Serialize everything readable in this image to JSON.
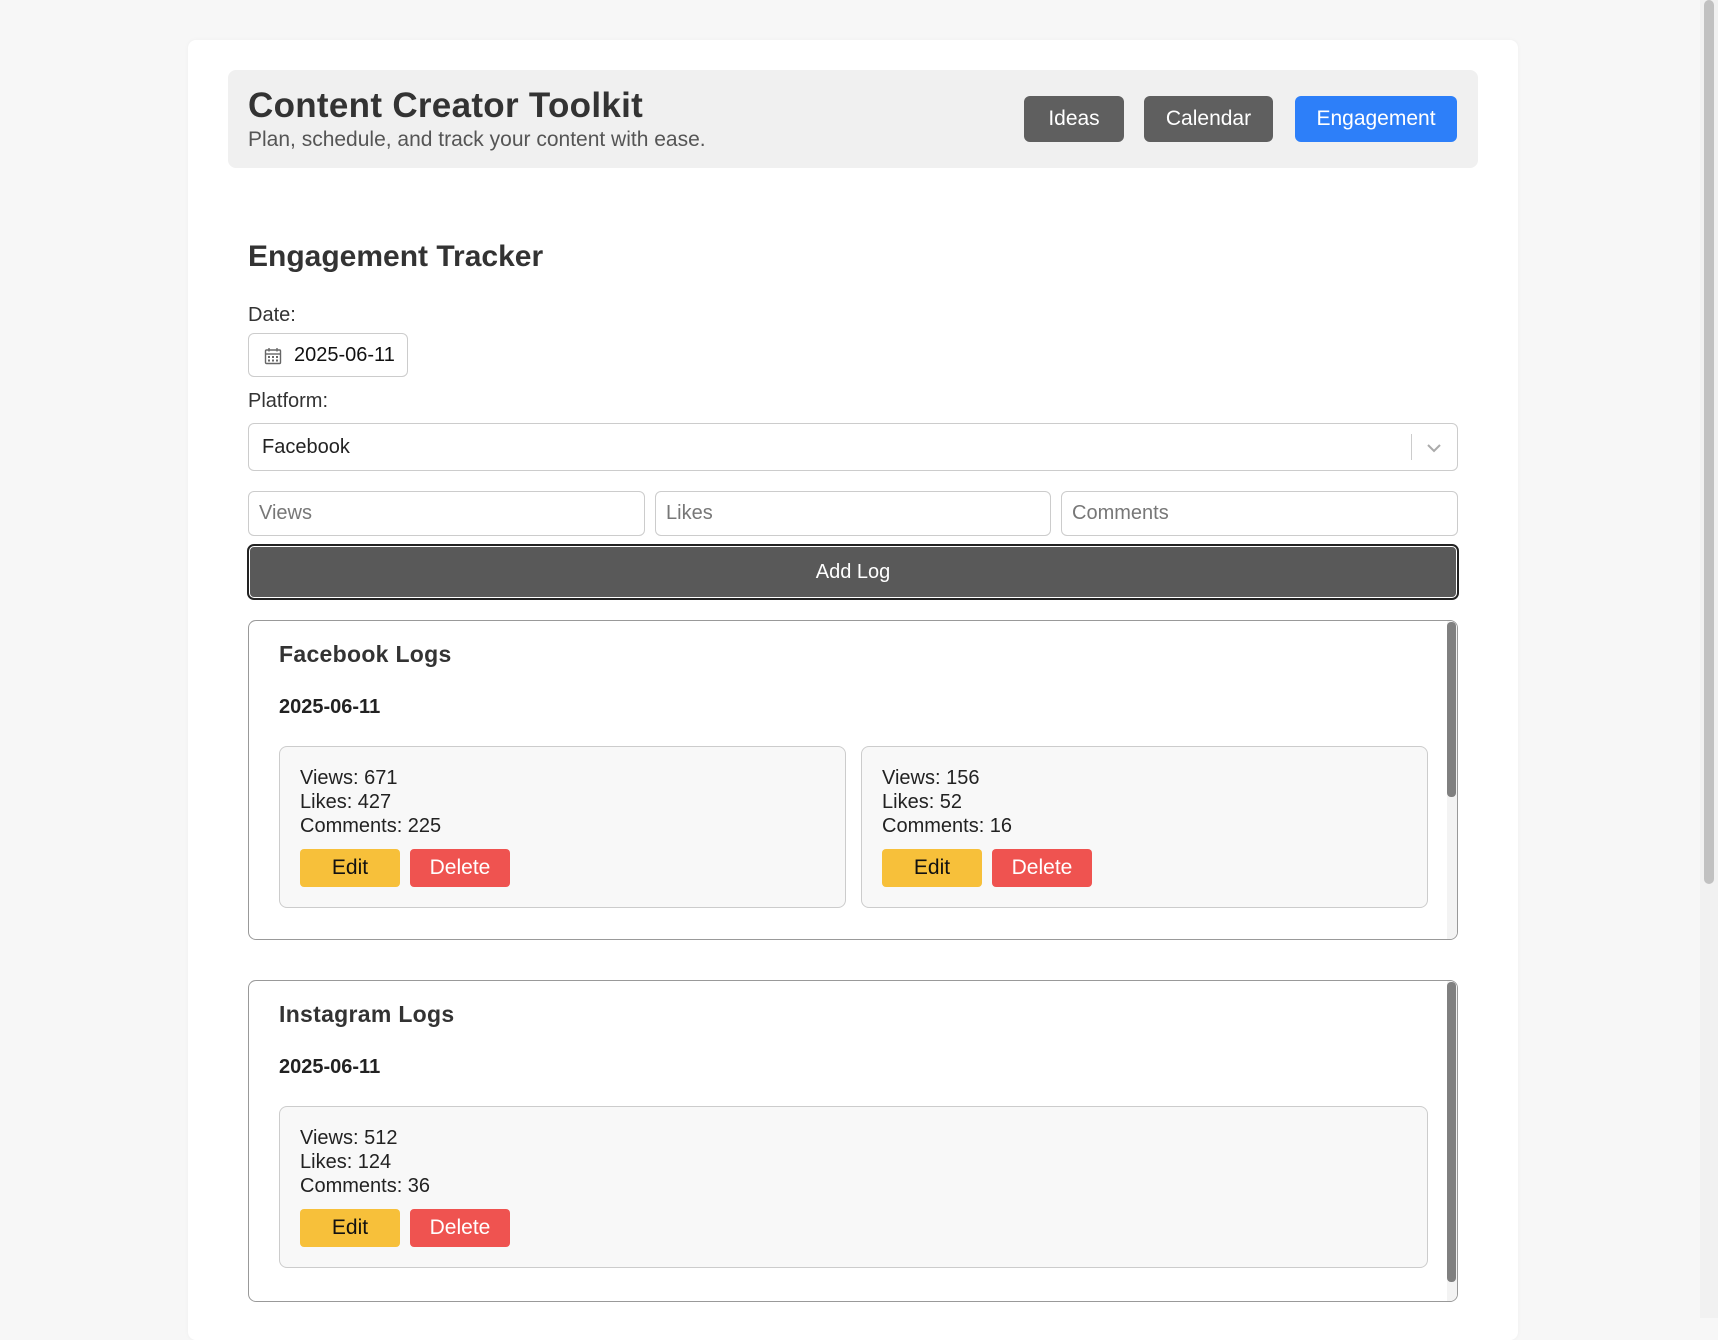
{
  "app": {
    "title": "Content Creator Toolkit",
    "subtitle": "Plan, schedule, and track your content with ease."
  },
  "nav": {
    "ideas": "Ideas",
    "calendar": "Calendar",
    "engagement": "Engagement",
    "active": "Engagement",
    "active_color": "#2d7ff9"
  },
  "tracker": {
    "title": "Engagement Tracker",
    "date_label": "Date:",
    "date_value": "2025-06-11",
    "platform_label": "Platform:",
    "platform_value": "Facebook",
    "views_placeholder": "Views",
    "likes_placeholder": "Likes",
    "comments_placeholder": "Comments",
    "add_button": "Add Log"
  },
  "panels": [
    {
      "title": "Facebook Logs",
      "date": "2025-06-11",
      "logs": [
        {
          "views": "Views: 671",
          "likes": "Likes: 427",
          "comments": "Comments: 225"
        },
        {
          "views": "Views: 156",
          "likes": "Likes: 52",
          "comments": "Comments: 16"
        }
      ]
    },
    {
      "title": "Instagram Logs",
      "date": "2025-06-11",
      "logs": [
        {
          "views": "Views: 512",
          "likes": "Likes: 124",
          "comments": "Comments: 36"
        }
      ]
    }
  ],
  "actions": {
    "edit": "Edit",
    "delete": "Delete",
    "edit_color": "#f7c03a",
    "delete_color": "#ef5350"
  },
  "icons": {
    "date": "calendar-icon",
    "select": "chevron-down-icon"
  }
}
